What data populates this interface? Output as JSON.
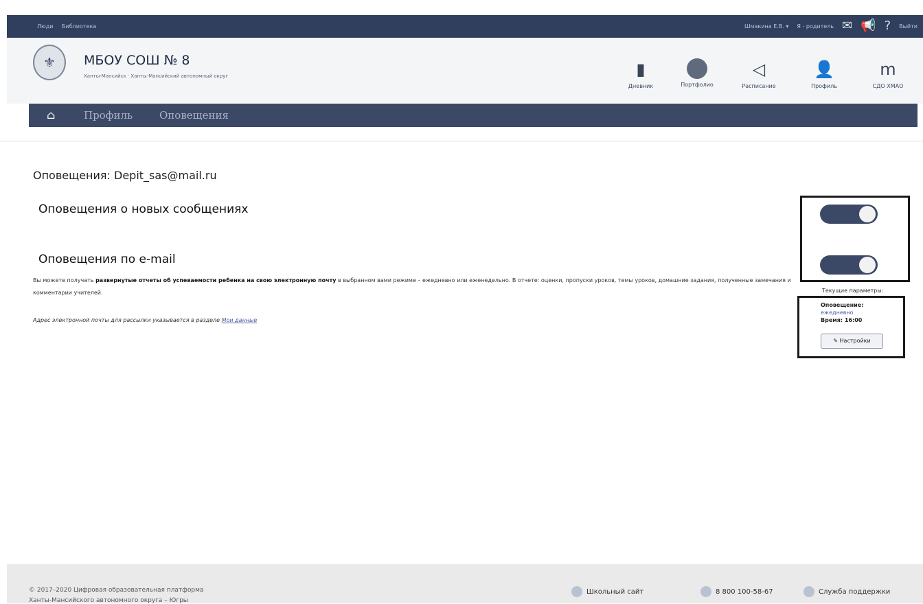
{
  "topbar": {
    "links": [
      "Люди",
      "Библиотека"
    ],
    "user": "Шмакина Е.В.",
    "user_chevron": "▾",
    "role": "Я - родитель",
    "exit": "Выйти",
    "mail_icon": "✉",
    "announce_icon": "📢",
    "help_icon": "?"
  },
  "header": {
    "school_name": "МБОУ СОШ № 8",
    "location": "Ханты-Мансийск · Ханты-Мансийский автономный округ",
    "logo_icon": "⚜",
    "quick_links": [
      {
        "label": "Дневник",
        "icon": "▮"
      },
      {
        "label": "Портфолио",
        "icon": ""
      },
      {
        "label": "Расписание",
        "icon": "◁"
      },
      {
        "label": "Профиль",
        "icon": "👤"
      },
      {
        "label": "СДО ХМАО",
        "icon": "m"
      }
    ]
  },
  "nav": {
    "home_icon": "⌂",
    "crumbs": [
      "Профиль",
      "Оповещения"
    ]
  },
  "main": {
    "title": "Оповещения: Depit_sas@mail.ru",
    "section_messages": "Оповещения о новых сообщениях",
    "section_email": "Оповещения по e-mail",
    "desc_prefix": "Вы можете получать ",
    "desc_bold": "развернутые отчеты об успеваемости ребенка на свою электронную почту",
    "desc_suffix": " в выбранном вами режиме – ежедневно или еженедельно. В отчете: оценки, пропуски уроков, темы уроков, домашние задания, полученные замечания и комментарии учителей.",
    "addr_text": "Адрес электронной почты для рассылки указывается в разделе ",
    "addr_link": "Мои данные"
  },
  "toggles": {
    "messages_on": true,
    "email_on": true
  },
  "params": {
    "label": "Текущие параметры:",
    "notify_label": "Оповещение:",
    "notify_value": "ежедневно",
    "time": "Время: 16:00",
    "settings_button": "Настройки",
    "settings_icon": "✎"
  },
  "footer": {
    "copyright": "© 2017–2020 Цифровая образовательная платформа",
    "copyright2": "Ханты-Мансийского автономного округа – Югры",
    "school_site": "Школьный сайт",
    "phone": "8 800 100-58-67",
    "support": "Служба поддержки"
  }
}
